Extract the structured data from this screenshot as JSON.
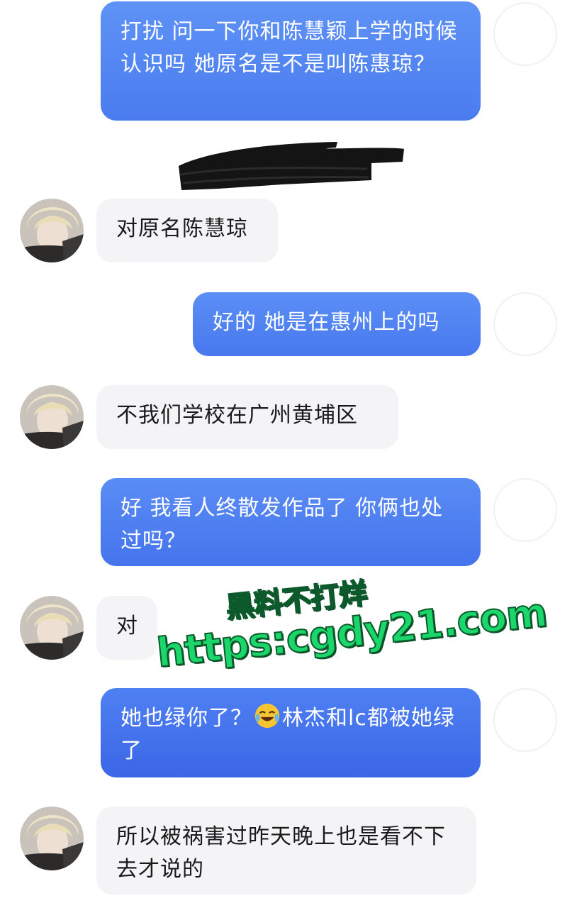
{
  "colors": {
    "outgoing_top": "#5c8ff5",
    "outgoing_bottom": "#3d6ee8",
    "incoming_bubble": "#f4f4f6",
    "watermark_fill": "#1bd66b",
    "watermark_stroke": "#0c5a2c"
  },
  "messages": [
    {
      "id": "m1",
      "side": "out",
      "text": "打扰  问一下你和陈慧颖上学的时候认识吗  她原名是不是叫陈惠琼？"
    },
    {
      "id": "m2",
      "side": "in",
      "text": "对原名陈慧琼"
    },
    {
      "id": "m3",
      "side": "out",
      "text": "好的  她是在惠州上的吗"
    },
    {
      "id": "m4",
      "side": "in",
      "text": "不我们学校在广州黄埔区"
    },
    {
      "id": "m5",
      "side": "out",
      "text": "好  我看人终散发作品了  你俩也处过吗？"
    },
    {
      "id": "m6",
      "side": "in",
      "text": "对"
    },
    {
      "id": "m7",
      "side": "out",
      "text_before": "她也绿你了？",
      "emoji": "crying-laughing-emoji",
      "text_after": "林杰和lc都被她绿了"
    },
    {
      "id": "m8",
      "side": "in",
      "text": "所以被祸害过昨天晚上也是看不下去才说的"
    }
  ],
  "watermark": {
    "line1": "黑料不打烊",
    "line2": "https:cgdy21.com"
  },
  "icons": {
    "self_avatar": "blank-avatar-icon",
    "peer_avatar": "blond-person-avatar-icon",
    "redaction": "redaction-scribble"
  }
}
